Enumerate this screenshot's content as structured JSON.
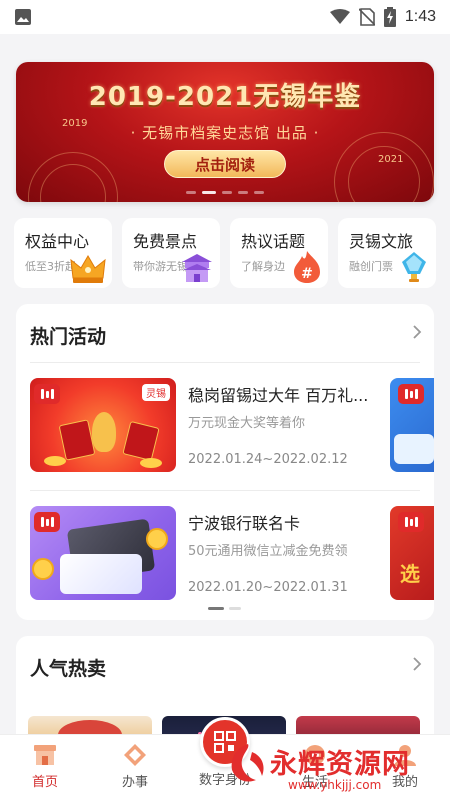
{
  "status_bar": {
    "time": "1:43",
    "icons": [
      "image-icon",
      "wifi-icon",
      "no-sim-icon",
      "battery-charging-icon"
    ]
  },
  "banner": {
    "title": "2019-2021无锡年鉴",
    "subtitle": "· 无锡市档案史志馆 出品 ·",
    "year_start": "2019",
    "year_end": "2021",
    "button_label": "点击阅读",
    "dots_count": 5,
    "active_dot": 1
  },
  "quick_links": [
    {
      "title": "权益中心",
      "subtitle": "低至3折起",
      "icon": "crown-icon"
    },
    {
      "title": "免费景点",
      "subtitle": "带你游无锡",
      "icon": "temple-icon"
    },
    {
      "title": "热议话题",
      "subtitle": "了解身边",
      "icon": "hashtag-flame-icon"
    },
    {
      "title": "灵锡文旅",
      "subtitle": "融创门票",
      "icon": "lantern-icon"
    }
  ],
  "hot_activities": {
    "title": "热门活动",
    "items": [
      {
        "title": "稳岗留锡过大年 百万礼...",
        "description": "万元现金大奖等着你",
        "date_range": "2022.01.24~2022.02.12",
        "thumb_brand": "灵锡"
      },
      {
        "title": "宁波银行联名卡",
        "description": "50元通用微信立减金免费领",
        "date_range": "2022.01.20~2022.01.31",
        "thumb_brand": ""
      }
    ],
    "peek_text": "选"
  },
  "popular": {
    "title": "人气热卖"
  },
  "bottom_nav": {
    "items": [
      {
        "label": "首页",
        "icon": "home-shop-icon",
        "active": true
      },
      {
        "label": "办事",
        "icon": "diamond-task-icon",
        "active": false
      },
      {
        "label": "数字身份",
        "icon": "digital-id-icon",
        "active": false
      },
      {
        "label": "生活",
        "icon": "life-icon",
        "active": false
      },
      {
        "label": "我的",
        "icon": "profile-icon",
        "active": false
      }
    ]
  },
  "watermark": {
    "text": "永辉资源网",
    "url": "www.yhkjjj.com"
  },
  "colors": {
    "accent": "#e3342a",
    "banner_red": "#b51418",
    "gold": "#ffe7b3",
    "text_primary": "#222222",
    "text_secondary": "#999999"
  }
}
